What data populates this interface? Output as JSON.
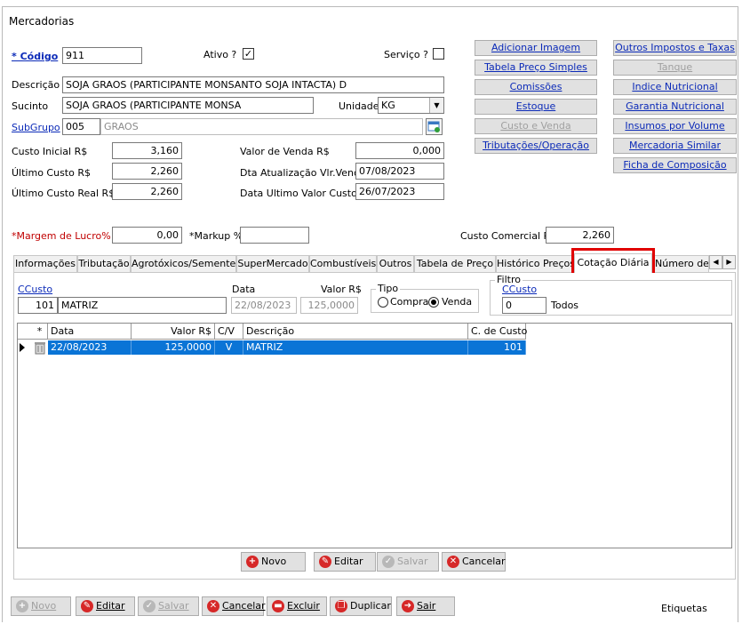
{
  "window": {
    "title": "Mercadorias"
  },
  "form": {
    "codigo_label": "* Código",
    "codigo_value": "911",
    "ativo_label": "Ativo ?",
    "ativo_checked": "✓",
    "servico_label": "Serviço ?",
    "servico_checked": "",
    "descricao_label": "Descrição",
    "descricao_value": "SOJA GRAOS (PARTICIPANTE MONSANTO SOJA INTACTA) D",
    "sucinto_label": "Sucinto",
    "sucinto_value": "SOJA GRAOS (PARTICIPANTE MONSA",
    "unidade_label": "Unidade",
    "unidade_value": "KG",
    "subgrupo_label": "SubGrupo",
    "subgrupo_code": "005",
    "subgrupo_name": "GRAOS",
    "custo_inicial_label": "Custo Inicial R$",
    "custo_inicial_value": "3,160",
    "ultimo_custo_label": "Último Custo R$",
    "ultimo_custo_value": "2,260",
    "ultimo_custo_real_label": "Último Custo Real R$",
    "ultimo_custo_real_value": "2,260",
    "valor_venda_label": "Valor de Venda R$",
    "valor_venda_value": "0,000",
    "dta_atualizacao_label": "Dta Atualização Vlr.Venda",
    "dta_atualizacao_value": "07/08/2023",
    "data_ultimo_custo_label": "Data Ultimo Valor Custo",
    "data_ultimo_custo_value": "26/07/2023",
    "margem_label": "*Margem de Lucro%",
    "margem_value": "0,00",
    "markup_label": "*Markup %",
    "markup_value": "",
    "custo_comercial_label": "Custo Comercial R$",
    "custo_comercial_value": "2,260"
  },
  "side_buttons": {
    "adicionar_imagem": "Adicionar Imagem",
    "tabela_preco_simples": "Tabela Preço Simples",
    "comissoes": "Comissões",
    "estoque": "Estoque",
    "custo_e_venda": "Custo e Venda",
    "tributacoes_operacao": "Tributações/Operação",
    "outros_impostos": "Outros Impostos e Taxas",
    "tanque": "Tanque",
    "indice_nutricional": "Indice Nutricional",
    "garantia_nutricional": "Garantia Nutricional",
    "insumos_por_volume": "Insumos por Volume",
    "mercadoria_similar": "Mercadoria Similar",
    "ficha_composicao": "Ficha de Composição"
  },
  "tabs": [
    "Informações",
    "Tributação",
    "Agrotóxicos/Sementes",
    "SuperMercado",
    "Combustíveis",
    "Outros",
    "Tabela de Preço",
    "Histórico Preços",
    "Cotação Diária",
    "Número de S"
  ],
  "cotacao": {
    "ccusto_label": "CCusto",
    "ccusto_code": "101",
    "ccusto_name": "MATRIZ",
    "data_label": "Data",
    "data_value": "22/08/2023",
    "valor_label": "Valor R$",
    "valor_value": "125,0000",
    "tipo_label": "Tipo",
    "compra_label": "Compra",
    "venda_label": "Venda",
    "tipo_selected": "Venda",
    "filtro_label": "Filtro",
    "filtro_ccusto_label": "CCusto",
    "filtro_value": "0",
    "todos_label": "Todos",
    "grid": {
      "columns": [
        "*",
        "Data",
        "Valor R$",
        "C/V",
        "Descrição",
        "C. de Custo"
      ],
      "rows": [
        {
          "data": "22/08/2023",
          "valor": "125,0000",
          "cv": "V",
          "descricao": "MATRIZ",
          "ccusto": "101"
        }
      ]
    },
    "buttons": {
      "novo": "Novo",
      "editar": "Editar",
      "salvar": "Salvar",
      "cancelar": "Cancelar"
    }
  },
  "bottom_bar": {
    "novo": "Novo",
    "editar": "Editar",
    "salvar": "Salvar",
    "cancelar": "Cancelar",
    "excluir": "Excluir",
    "duplicar": "Duplicar",
    "sair": "Sair",
    "etiquetas": "Etiquetas"
  }
}
